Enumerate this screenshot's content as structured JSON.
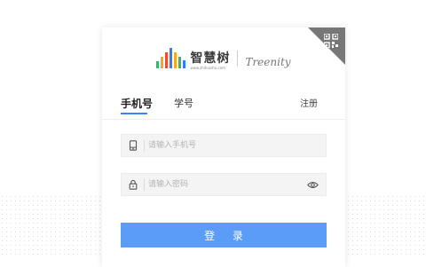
{
  "logo": {
    "name": "智慧树",
    "url": "www.zhihuishu.com",
    "partner": "Treenity"
  },
  "tabs": {
    "phone": "手机号",
    "student": "学号",
    "register": "注册"
  },
  "form": {
    "phone_placeholder": "请输入手机号",
    "password_placeholder": "请输入密码"
  },
  "login_button": "登 录",
  "colors": {
    "accent": "#3d82f6",
    "button": "#5b9cf8",
    "corner": "#777777"
  }
}
